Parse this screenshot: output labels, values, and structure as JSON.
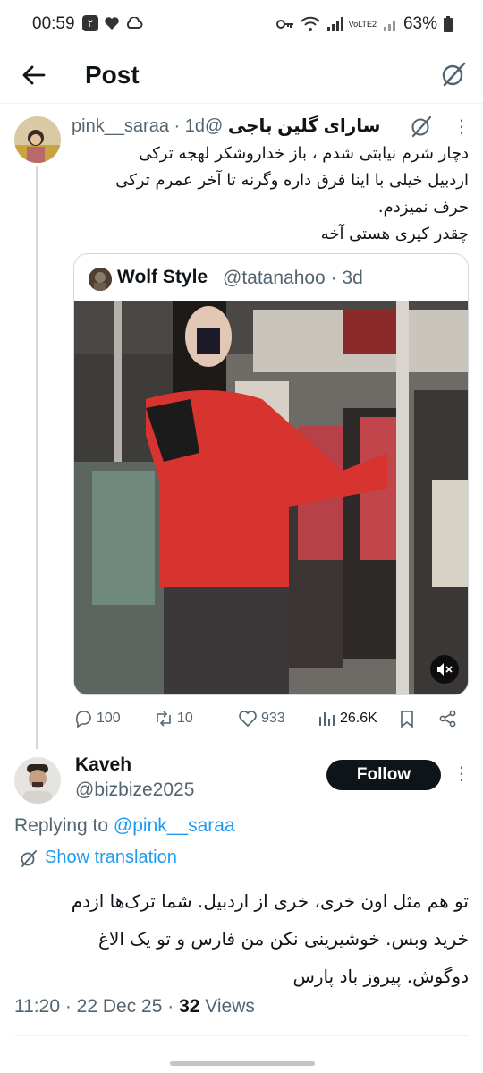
{
  "status_bar": {
    "time": "00:59",
    "badge": "۲",
    "network": "VoLTE2",
    "battery": "63%",
    "icons": [
      "heart-icon",
      "cloud-icon",
      "key-icon",
      "wifi-icon",
      "signal-icon",
      "battery-icon"
    ]
  },
  "header": {
    "title": "Post",
    "back_icon": "arrow-left-icon",
    "grok_icon": "grok-icon"
  },
  "tweet1": {
    "name": "سارای گلین باجی",
    "handle": "@pink__saraa · 1d",
    "body_lines": [
      "دچار شرم نیابتی شدم ، باز خداروشکر لهجه ترکی",
      "اردبیل خیلی با اینا فرق داره وگرنه تا آخر عمرم ترکی",
      "حرف نمیزدم.",
      "چقدر کیری هستی آخه"
    ],
    "quote": {
      "name": "Wolf Style",
      "meta": "@tatanahoo · 3d"
    },
    "stats": {
      "replies": "100",
      "reposts": "10",
      "likes": "933",
      "views": "26.6K"
    }
  },
  "tweet2": {
    "name": "Kaveh",
    "handle": "@bizbize2025",
    "follow_label": "Follow",
    "replying_prefix": "Replying to ",
    "replying_to": "@pink__saraa",
    "show_translation": "Show translation",
    "body_lines": [
      "تو هم مثل اون خری، خری از اردبیل. شما ترک‌ها ازدم",
      "خرید وبس. خوشیرینی نکن من فارس و تو یک الاغ",
      "دوگوش. پیروز باد پارس"
    ],
    "time_date": "11:20 · 22 Dec 25 · ",
    "views_count": "32",
    "views_label": " Views"
  },
  "colors": {
    "accent": "#1d9bf0",
    "text": "#0f1419",
    "muted": "#536471",
    "border": "#cfd9de"
  }
}
